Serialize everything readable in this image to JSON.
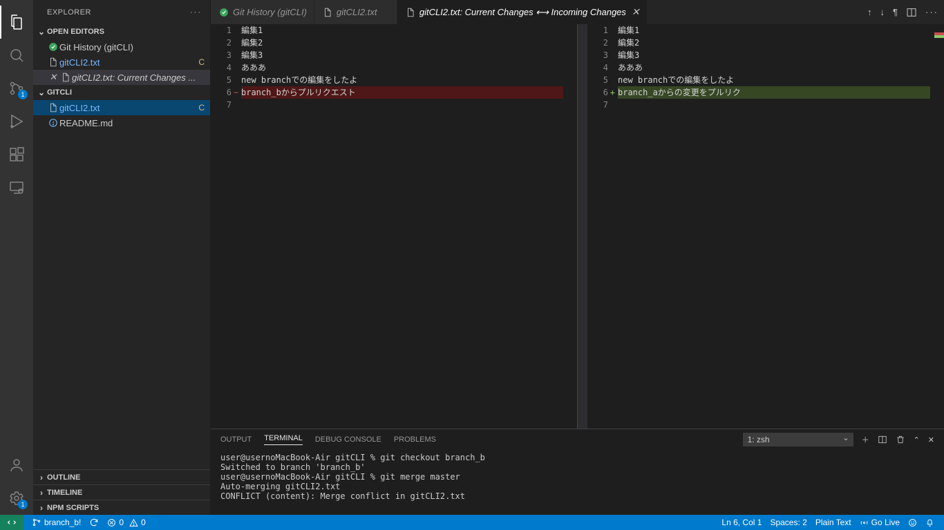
{
  "sidebar": {
    "title": "EXPLORER",
    "openEditorsTitle": "OPEN EDITORS",
    "openEditors": [
      {
        "label": "Git History (gitCLI)",
        "status": ""
      },
      {
        "label": "gitCLI2.txt",
        "status": "C"
      },
      {
        "label": "gitCLI2.txt: Current Changes ...",
        "status": ""
      }
    ],
    "repoTitle": "GITCLI",
    "repoFiles": [
      {
        "label": "gitCLI2.txt",
        "status": "C"
      },
      {
        "label": "README.md",
        "status": ""
      }
    ],
    "collapsed": [
      "OUTLINE",
      "TIMELINE",
      "NPM SCRIPTS"
    ]
  },
  "tabs": [
    {
      "label": "Git History (gitCLI)"
    },
    {
      "label": "gitCLI2.txt"
    },
    {
      "label": "gitCLI2.txt: Current Changes ⟷ Incoming Changes"
    }
  ],
  "diff": {
    "left": [
      "編集1",
      "編集2",
      "編集3",
      "あああ",
      "new branchでの編集をしたよ",
      "branch_bからプルリクエスト",
      ""
    ],
    "right": [
      "編集1",
      "編集2",
      "編集3",
      "あああ",
      "new branchでの編集をしたよ",
      "branch_aからの変更をプルリク",
      ""
    ],
    "changeLine": 6
  },
  "panel": {
    "tabs": [
      "OUTPUT",
      "TERMINAL",
      "DEBUG CONSOLE",
      "PROBLEMS"
    ],
    "activeTab": "TERMINAL",
    "terminalName": "1: zsh",
    "terminalText": "user@usernoMacBook-Air gitCLI % git checkout branch_b\nSwitched to branch 'branch_b'\nuser@usernoMacBook-Air gitCLI % git merge master\nAuto-merging gitCLI2.txt\nCONFLICT (content): Merge conflict in gitCLI2.txt"
  },
  "statusBar": {
    "branch": "branch_b!",
    "sync": "",
    "errors": "0",
    "warnings": "0",
    "cursor": "Ln 6, Col 1",
    "spaces": "Spaces: 2",
    "lang": "Plain Text",
    "golive": "Go Live"
  },
  "scmBadge": "1",
  "settingsBadge": "1"
}
